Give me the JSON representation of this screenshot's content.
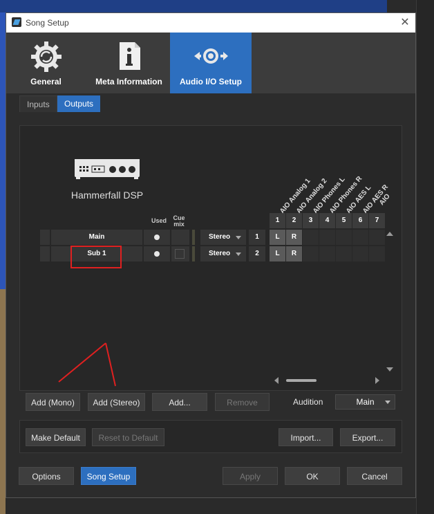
{
  "window": {
    "title": "Song Setup",
    "close_glyph": "✕"
  },
  "main_tabs": [
    {
      "label": "General",
      "icon": "gear-refresh-icon"
    },
    {
      "label": "Meta Information",
      "icon": "info-document-icon"
    },
    {
      "label": "Audio I/O Setup",
      "icon": "speaker-io-icon",
      "active": true
    }
  ],
  "sub_tabs": {
    "inputs": "Inputs",
    "outputs": "Outputs",
    "active": "Outputs"
  },
  "device": {
    "name": "Hammerfall DSP",
    "icon": "audio-interface-icon"
  },
  "columns": {
    "used": "Used",
    "cue_mix": "Cue mix"
  },
  "channels": [
    "AIO Analog 1",
    "AIO Analog 2",
    "AIO Phones L",
    "AIO Phones R",
    "AIO AES L",
    "AIO AES R",
    "AIO"
  ],
  "channel_numbers": [
    "1",
    "2",
    "3",
    "4",
    "5",
    "6",
    "7"
  ],
  "rows": [
    {
      "name": "Main",
      "used": true,
      "cue": false,
      "mode": "Stereo",
      "number": "1",
      "matrix": [
        "L",
        "R",
        "",
        "",
        "",
        "",
        ""
      ]
    },
    {
      "name": "Sub 1",
      "used": true,
      "cue": true,
      "mode": "Stereo",
      "number": "2",
      "matrix": [
        "L",
        "R",
        "",
        "",
        "",
        "",
        ""
      ]
    }
  ],
  "actions": {
    "add_mono": "Add (Mono)",
    "add_stereo": "Add (Stereo)",
    "add": "Add...",
    "remove": "Remove",
    "audition_label": "Audition",
    "audition_value": "Main"
  },
  "defaults": {
    "make_default": "Make Default",
    "reset_default": "Reset to Default",
    "import": "Import...",
    "export": "Export..."
  },
  "footer": {
    "options": "Options",
    "song_setup": "Song Setup",
    "apply": "Apply",
    "ok": "OK",
    "cancel": "Cancel"
  },
  "colors": {
    "accent": "#2d6fbf",
    "annotation": "#e02020"
  }
}
